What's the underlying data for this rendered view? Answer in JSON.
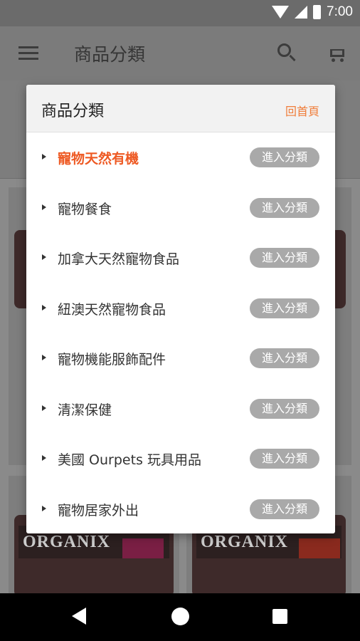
{
  "status_bar": {
    "time": "7:00"
  },
  "app_bar": {
    "title": "商品分類"
  },
  "dialog": {
    "title": "商品分類",
    "home_link": "回首頁",
    "active_color": "#ee5a24",
    "categories": [
      {
        "label": "寵物天然有機",
        "button": "進入分類",
        "active": true
      },
      {
        "label": "寵物餐食",
        "button": "進入分類"
      },
      {
        "label": "加拿大天然寵物食品",
        "button": "進入分類"
      },
      {
        "label": "紐澳天然寵物食品",
        "button": "進入分類"
      },
      {
        "label": "寵物機能服飾配件",
        "button": "進入分類"
      },
      {
        "label": "清潔保健",
        "button": "進入分類"
      },
      {
        "label": "美國 Ourpets 玩具用品",
        "button": "進入分類"
      },
      {
        "label": "寵物居家外出",
        "button": "進入分類"
      }
    ]
  },
  "background_products": [
    {
      "brand": "ORGANIX"
    },
    {
      "brand": "ORGANIX"
    }
  ],
  "icons": [
    "menu-icon",
    "search-icon",
    "cart-icon",
    "wifi-icon",
    "signal-icon",
    "battery-icon",
    "back-icon",
    "home-icon",
    "recents-icon"
  ]
}
